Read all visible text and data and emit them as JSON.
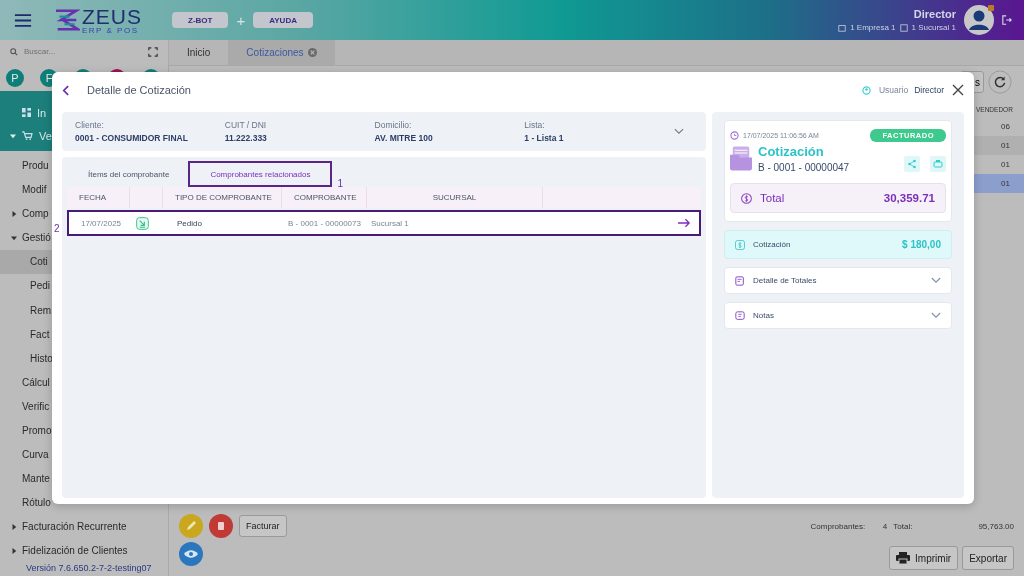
{
  "header": {
    "logo": {
      "title": "ZEUS",
      "subtitle": "ERP & POS"
    },
    "buttons": [
      "Z-BOT",
      "AYUDA"
    ],
    "separator": "+",
    "user_name": "Director",
    "company": "1 Empresa 1",
    "branch": "1 Sucursal 1"
  },
  "sidebar": {
    "search_placeholder": "Buscar...",
    "shortcuts": [
      {
        "label": "P",
        "color": "#0e7f78"
      },
      {
        "label": "F",
        "color": "#0e7f78"
      },
      {
        "color": "#0e7f78"
      },
      {
        "color": "#a30f58"
      },
      {
        "color": "#0e7f78"
      }
    ],
    "items": [
      {
        "label": "In",
        "selected": false
      },
      {
        "label": "Ve",
        "selected": false,
        "expanded": true,
        "children": [
          {
            "label": "Produ",
            "selected": false
          },
          {
            "label": "Modif",
            "selected": false
          },
          {
            "label": "Comp",
            "selected": false,
            "expanded": false
          },
          {
            "label": "Gestió",
            "selected": false,
            "expanded": true,
            "children": [
              {
                "label": "Coti",
                "selected": true
              },
              {
                "label": "Pedi",
                "selected": false
              },
              {
                "label": "Rem",
                "selected": false
              },
              {
                "label": "Fact",
                "selected": false
              },
              {
                "label": "Histo",
                "selected": false
              }
            ]
          },
          {
            "label": "Cálcul",
            "selected": false
          },
          {
            "label": "Verific",
            "selected": false
          },
          {
            "label": "Promo",
            "selected": false
          },
          {
            "label": "Curva",
            "selected": false
          },
          {
            "label": "Mante",
            "selected": false
          },
          {
            "label": "Rótulo",
            "selected": false
          },
          {
            "label": "Facturación Recurrente",
            "selected": false,
            "expanded": false
          },
          {
            "label": "Fidelización de Clientes",
            "selected": false,
            "expanded": false
          }
        ]
      }
    ],
    "version": "Versión 7.6.650.2-7-2-testing07"
  },
  "tabs": [
    {
      "label": "Inicio",
      "selected": false,
      "closable": false
    },
    {
      "label": "Cotizaciones",
      "selected": true,
      "closable": true
    }
  ],
  "list": {
    "toolbar_button": "s",
    "column": "VENDEDOR",
    "rows": [
      {
        "vendedor": "06",
        "selected": false
      },
      {
        "vendedor": "01",
        "selected": false
      },
      {
        "vendedor": "01",
        "selected": false
      },
      {
        "vendedor": "01",
        "selected": true
      }
    ]
  },
  "footer": {
    "actions": [
      "Facturar"
    ],
    "count_label": "Comprobantes:",
    "count": "4",
    "total_label": "Total:",
    "total": "95,763.00",
    "buttons": [
      "Imprimir",
      "Exportar"
    ]
  },
  "dialog": {
    "title": "Detalle de Cotización",
    "user_label": "Usuario",
    "user": "Director",
    "client": [
      {
        "label": "Cliente:",
        "value": "0001 - CONSUMIDOR FINAL"
      },
      {
        "label": "CUIT / DNI",
        "value": "11.222.333"
      },
      {
        "label": "Domicilio:",
        "value": "AV. MITRE 100"
      },
      {
        "label": "Lista:",
        "value": "1 - Lista 1"
      }
    ],
    "tabs": [
      {
        "label": "Ítems del comprobante",
        "selected": false
      },
      {
        "label": "Comprobantes relacionados",
        "selected": true
      }
    ],
    "annotations": [
      "1",
      "2"
    ],
    "columns": {
      "fecha": "FECHA",
      "tipo": "TIPO DE COMPROBANTE",
      "comprobante": "COMPROBANTE",
      "sucursal": "SUCURSAL"
    },
    "rows": [
      {
        "fecha": "17/07/2025",
        "tipo": "Pedido",
        "comprobante": "B - 0001 - 00000073",
        "sucursal": "Sucursal 1"
      }
    ],
    "summary": {
      "datetime": "17/07/2025 11:06:56 AM",
      "status": "FACTURADO",
      "type": "Cotización",
      "number": "B - 0001 - 00000047",
      "total_label": "Total",
      "total": "30,359.71"
    },
    "amount": {
      "label": "Cotización",
      "value": "$ 180,00"
    },
    "sections": [
      {
        "label": "Detalle de Totales",
        "expanded": false
      },
      {
        "label": "Notas",
        "expanded": false
      }
    ]
  }
}
